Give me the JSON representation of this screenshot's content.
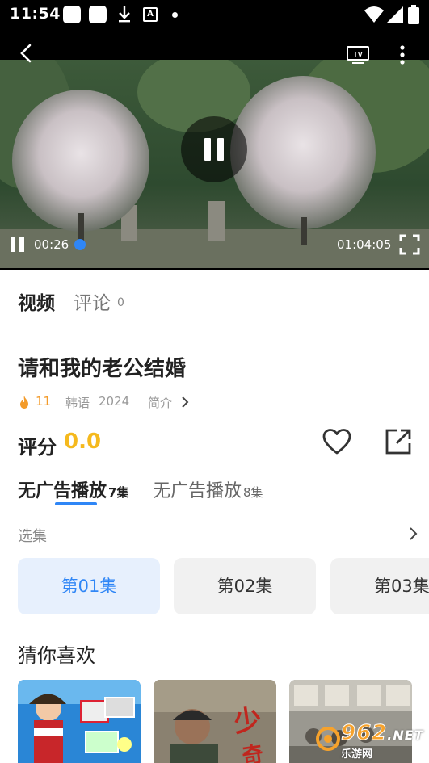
{
  "status_bar": {
    "time": "11:54",
    "font_icon_letter": "A",
    "icons": [
      "notification-square-icon",
      "notification-square-icon",
      "download-icon",
      "font-icon",
      "dot-icon",
      "wifi-icon",
      "signal-icon",
      "battery-icon"
    ]
  },
  "player": {
    "current_time": "00:26",
    "total_time": "01:04:05",
    "progress_fraction": 0.007,
    "is_playing": true,
    "tv_icon_label": "TV",
    "accent_color": "#2f86f6"
  },
  "tabs": {
    "video": "视频",
    "comments": "评论",
    "comment_count": "0"
  },
  "info": {
    "title": "请和我的老公结婚",
    "views": "11",
    "language": "韩语",
    "year": "2024",
    "intro": "简介"
  },
  "rating": {
    "label": "评分",
    "value": "0.0",
    "value_color": "#f5b91d"
  },
  "sources": [
    {
      "label": "无广告播放",
      "count": "7集",
      "active": true
    },
    {
      "label": "无广告播放",
      "count": "8集",
      "active": false
    }
  ],
  "episodes": {
    "header": "选集",
    "items": [
      "第01集",
      "第02集",
      "第03集"
    ],
    "selected": "第01集"
  },
  "recommend": {
    "title": "猜你喜欢"
  },
  "watermark": {
    "number": "962",
    "suffix": ".NET",
    "subtitle": "乐游网"
  }
}
